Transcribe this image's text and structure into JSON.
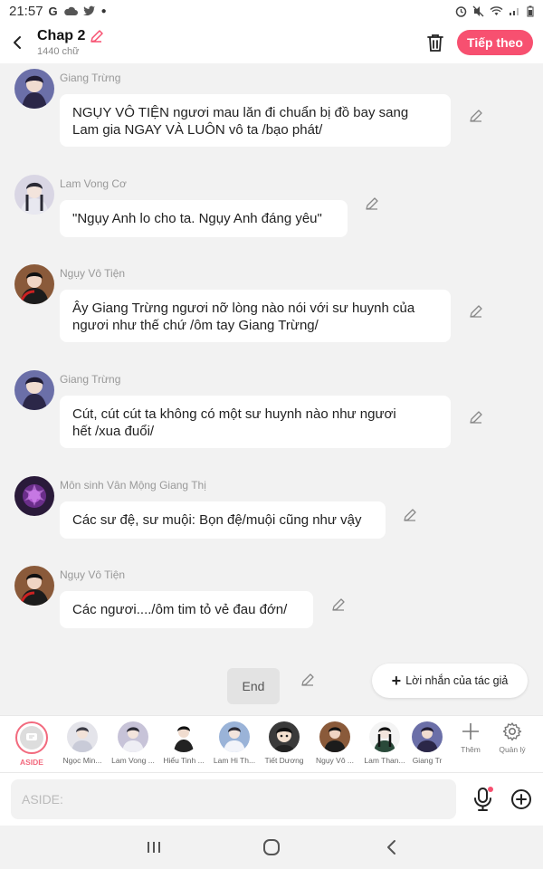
{
  "status_bar": {
    "time": "21:57"
  },
  "header": {
    "title": "Chap 2",
    "subtitle": "1440 chữ",
    "next_button": "Tiếp theo"
  },
  "messages": [
    {
      "sender": "Giang Trừng",
      "lines": [
        "NGỤY VÔ TIỆN ngươi mau lăn đi chuẩn bị đồ bay sang",
        "Lam gia NGAY VÀ LUÔN vô ta /bạo phát/"
      ]
    },
    {
      "sender": "Lam Vong Cơ",
      "lines": [
        "\"Ngụy Anh lo cho ta. Ngụy Anh đáng yêu\""
      ]
    },
    {
      "sender": "Ngụy Vô Tiện",
      "lines": [
        "Ây Giang Trừng ngươi nỡ lòng nào nói với sư huynh của",
        "ngươi như thế chứ /ôm tay Giang Trừng/"
      ]
    },
    {
      "sender": "Giang Trừng",
      "lines": [
        "Cút, cút cút ta không có một sư huynh nào như ngươi",
        "hết /xua đuổi/"
      ]
    },
    {
      "sender": "Môn sinh Vân Mộng Giang Thị",
      "lines": [
        "Các sư đệ, sư muội: Bọn đệ/muội cũng như vậy"
      ]
    },
    {
      "sender": "Ngụy Vô Tiện",
      "lines": [
        "Các ngươi..../ôm tim tỏ vẻ đau đớn/"
      ]
    }
  ],
  "end_label": "End",
  "author_note_label": "Lời nhắn của tác giả",
  "characters": [
    {
      "name": "ASIDE"
    },
    {
      "name": "Ngọc Min..."
    },
    {
      "name": "Lam Vong ..."
    },
    {
      "name": "Hiểu Tinh ..."
    },
    {
      "name": "Lam Hi Th..."
    },
    {
      "name": "Tiết Dương"
    },
    {
      "name": "Ngụy Vô ..."
    },
    {
      "name": "Lam Than..."
    },
    {
      "name": "Giang Tr"
    }
  ],
  "tools": {
    "add": "Thêm",
    "manage": "Quản lý"
  },
  "input": {
    "placeholder": "ASIDE:"
  },
  "colors": {
    "accent": "#f75070",
    "aside": "#f26a7e",
    "background": "#f2f2f2"
  }
}
